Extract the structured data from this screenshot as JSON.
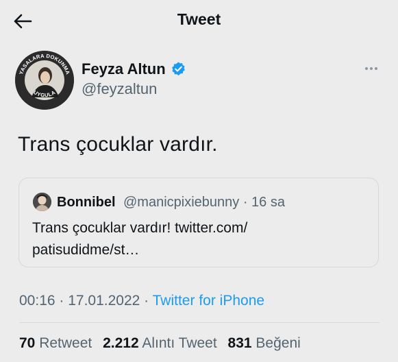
{
  "header": {
    "title": "Tweet"
  },
  "tweet": {
    "author_name": "Feyza Altun",
    "author_handle": "@feyzaltun",
    "avatar_ring_text_top": "YASALARA DOKUNMA",
    "avatar_ring_text_bottom": "UYGULA",
    "text": "Trans çocuklar vardır.",
    "time": "00:16",
    "date": "17.01.2022",
    "source": "Twitter for iPhone"
  },
  "quote": {
    "author_name": "Bonnibel",
    "meta": "@manicpixiebunny · 16 sa",
    "line1": "Trans çocuklar vardır! twitter.com/",
    "line2": "patisudidme/st…"
  },
  "stats": {
    "retweets": "70",
    "retweets_label": "Retweet",
    "quotes": "2.212",
    "quotes_label": "Alıntı Tweet",
    "likes": "831",
    "likes_label": "Beğeni"
  },
  "colors": {
    "background": "#ececec",
    "link": "#1d9bf0",
    "verified": "#1d9bf0",
    "secondary_text": "#536471"
  },
  "icons": {
    "back": "arrow-left-icon",
    "verified": "verified-badge-icon",
    "more": "more-horizontal-icon"
  }
}
